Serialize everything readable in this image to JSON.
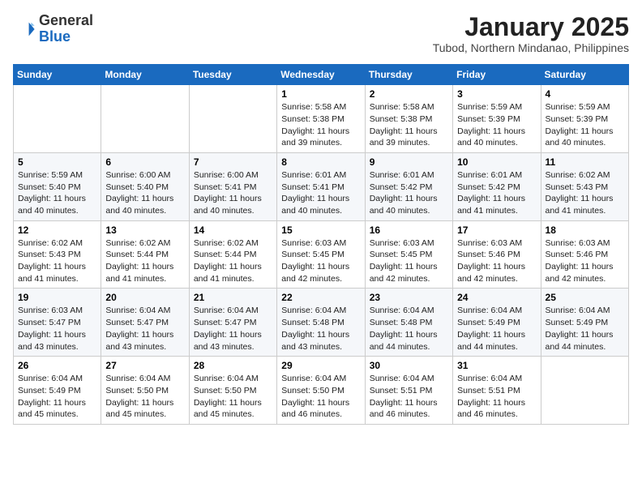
{
  "logo": {
    "general": "General",
    "blue": "Blue"
  },
  "title": "January 2025",
  "location": "Tubod, Northern Mindanao, Philippines",
  "days_header": [
    "Sunday",
    "Monday",
    "Tuesday",
    "Wednesday",
    "Thursday",
    "Friday",
    "Saturday"
  ],
  "weeks": [
    [
      {
        "day": "",
        "text": ""
      },
      {
        "day": "",
        "text": ""
      },
      {
        "day": "",
        "text": ""
      },
      {
        "day": "1",
        "text": "Sunrise: 5:58 AM\nSunset: 5:38 PM\nDaylight: 11 hours and 39 minutes."
      },
      {
        "day": "2",
        "text": "Sunrise: 5:58 AM\nSunset: 5:38 PM\nDaylight: 11 hours and 39 minutes."
      },
      {
        "day": "3",
        "text": "Sunrise: 5:59 AM\nSunset: 5:39 PM\nDaylight: 11 hours and 40 minutes."
      },
      {
        "day": "4",
        "text": "Sunrise: 5:59 AM\nSunset: 5:39 PM\nDaylight: 11 hours and 40 minutes."
      }
    ],
    [
      {
        "day": "5",
        "text": "Sunrise: 5:59 AM\nSunset: 5:40 PM\nDaylight: 11 hours and 40 minutes."
      },
      {
        "day": "6",
        "text": "Sunrise: 6:00 AM\nSunset: 5:40 PM\nDaylight: 11 hours and 40 minutes."
      },
      {
        "day": "7",
        "text": "Sunrise: 6:00 AM\nSunset: 5:41 PM\nDaylight: 11 hours and 40 minutes."
      },
      {
        "day": "8",
        "text": "Sunrise: 6:01 AM\nSunset: 5:41 PM\nDaylight: 11 hours and 40 minutes."
      },
      {
        "day": "9",
        "text": "Sunrise: 6:01 AM\nSunset: 5:42 PM\nDaylight: 11 hours and 40 minutes."
      },
      {
        "day": "10",
        "text": "Sunrise: 6:01 AM\nSunset: 5:42 PM\nDaylight: 11 hours and 41 minutes."
      },
      {
        "day": "11",
        "text": "Sunrise: 6:02 AM\nSunset: 5:43 PM\nDaylight: 11 hours and 41 minutes."
      }
    ],
    [
      {
        "day": "12",
        "text": "Sunrise: 6:02 AM\nSunset: 5:43 PM\nDaylight: 11 hours and 41 minutes."
      },
      {
        "day": "13",
        "text": "Sunrise: 6:02 AM\nSunset: 5:44 PM\nDaylight: 11 hours and 41 minutes."
      },
      {
        "day": "14",
        "text": "Sunrise: 6:02 AM\nSunset: 5:44 PM\nDaylight: 11 hours and 41 minutes."
      },
      {
        "day": "15",
        "text": "Sunrise: 6:03 AM\nSunset: 5:45 PM\nDaylight: 11 hours and 42 minutes."
      },
      {
        "day": "16",
        "text": "Sunrise: 6:03 AM\nSunset: 5:45 PM\nDaylight: 11 hours and 42 minutes."
      },
      {
        "day": "17",
        "text": "Sunrise: 6:03 AM\nSunset: 5:46 PM\nDaylight: 11 hours and 42 minutes."
      },
      {
        "day": "18",
        "text": "Sunrise: 6:03 AM\nSunset: 5:46 PM\nDaylight: 11 hours and 42 minutes."
      }
    ],
    [
      {
        "day": "19",
        "text": "Sunrise: 6:03 AM\nSunset: 5:47 PM\nDaylight: 11 hours and 43 minutes."
      },
      {
        "day": "20",
        "text": "Sunrise: 6:04 AM\nSunset: 5:47 PM\nDaylight: 11 hours and 43 minutes."
      },
      {
        "day": "21",
        "text": "Sunrise: 6:04 AM\nSunset: 5:47 PM\nDaylight: 11 hours and 43 minutes."
      },
      {
        "day": "22",
        "text": "Sunrise: 6:04 AM\nSunset: 5:48 PM\nDaylight: 11 hours and 43 minutes."
      },
      {
        "day": "23",
        "text": "Sunrise: 6:04 AM\nSunset: 5:48 PM\nDaylight: 11 hours and 44 minutes."
      },
      {
        "day": "24",
        "text": "Sunrise: 6:04 AM\nSunset: 5:49 PM\nDaylight: 11 hours and 44 minutes."
      },
      {
        "day": "25",
        "text": "Sunrise: 6:04 AM\nSunset: 5:49 PM\nDaylight: 11 hours and 44 minutes."
      }
    ],
    [
      {
        "day": "26",
        "text": "Sunrise: 6:04 AM\nSunset: 5:49 PM\nDaylight: 11 hours and 45 minutes."
      },
      {
        "day": "27",
        "text": "Sunrise: 6:04 AM\nSunset: 5:50 PM\nDaylight: 11 hours and 45 minutes."
      },
      {
        "day": "28",
        "text": "Sunrise: 6:04 AM\nSunset: 5:50 PM\nDaylight: 11 hours and 45 minutes."
      },
      {
        "day": "29",
        "text": "Sunrise: 6:04 AM\nSunset: 5:50 PM\nDaylight: 11 hours and 46 minutes."
      },
      {
        "day": "30",
        "text": "Sunrise: 6:04 AM\nSunset: 5:51 PM\nDaylight: 11 hours and 46 minutes."
      },
      {
        "day": "31",
        "text": "Sunrise: 6:04 AM\nSunset: 5:51 PM\nDaylight: 11 hours and 46 minutes."
      },
      {
        "day": "",
        "text": ""
      }
    ]
  ]
}
